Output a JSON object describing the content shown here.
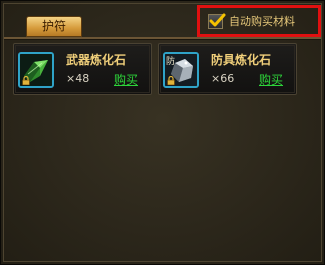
{
  "tab": {
    "label": "护符"
  },
  "auto_buy": {
    "label": "自动购买材料",
    "checked": true
  },
  "items": [
    {
      "name": "武器炼化石",
      "quantity": "×48",
      "buy_label": "购买",
      "icon": "green-crystal-icon"
    },
    {
      "name": "防具炼化石",
      "quantity": "×66",
      "buy_label": "购买",
      "icon": "gray-stone-icon",
      "icon_prefix": "防"
    }
  ],
  "colors": {
    "item_name": "#f0cf7a",
    "buy_link": "#2dd63a",
    "slot_border": "#2fa3c8",
    "highlight_border": "#e01010"
  }
}
